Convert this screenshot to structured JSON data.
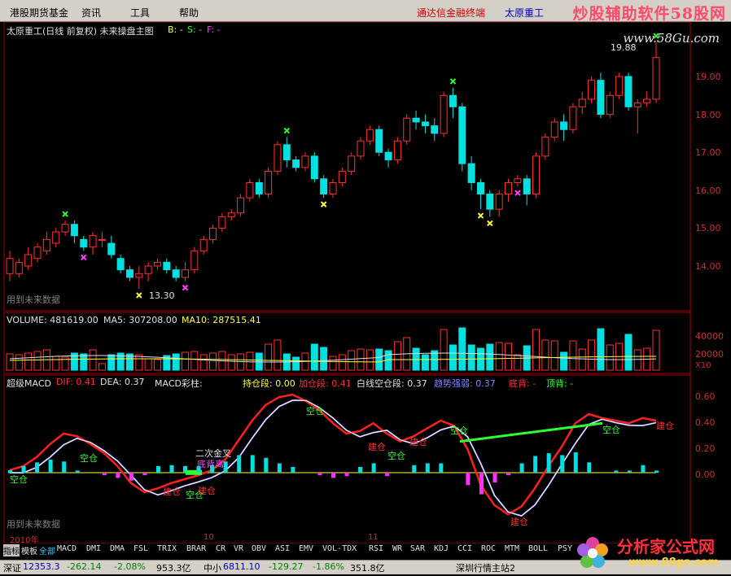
{
  "menu": {
    "items": [
      "港股期货基金",
      "资讯",
      "工具",
      "帮助"
    ],
    "ad_left": "通达信金融终端",
    "ad_right": "太原重工",
    "watermark": "炒股辅助软件58股网",
    "watermark_url": "www.58Gu.com"
  },
  "main_chart": {
    "title": "太原重工(日线 前复权) 未来操盘主图",
    "b_label": "B: -",
    "s_label": "S: -",
    "f_label": "F: -",
    "y_ticks": [
      "19.00",
      "18.00",
      "17.00",
      "16.00",
      "15.00",
      "14.00"
    ],
    "low_marker": "13.30",
    "top_marker": "19.88",
    "footer": "用到未来数据",
    "colors": {
      "up": "#ff3030",
      "down": "#00e0e0",
      "buy": "#ffff40",
      "sell": "#30ff30",
      "mark": "#ff40ff"
    }
  },
  "chart_data": {
    "type": "candlestick",
    "y_range": [
      13.0,
      20.0
    ],
    "candles": [
      [
        13.8,
        14.2,
        13.6,
        14.4
      ],
      [
        13.8,
        14.1,
        13.7,
        14.2
      ],
      [
        14.0,
        14.3,
        13.9,
        14.5
      ],
      [
        14.2,
        14.5,
        14.1,
        14.6
      ],
      [
        14.4,
        14.7,
        14.3,
        14.9
      ],
      [
        14.6,
        14.9,
        14.5,
        15.0
      ],
      [
        14.9,
        15.1,
        14.8,
        15.2
      ],
      [
        15.1,
        14.8,
        14.6,
        15.2
      ],
      [
        14.7,
        14.5,
        14.4,
        14.8
      ],
      [
        14.5,
        14.8,
        14.3,
        14.9
      ],
      [
        14.7,
        14.7,
        14.5,
        14.9
      ],
      [
        14.6,
        14.3,
        14.2,
        14.8
      ],
      [
        14.2,
        13.9,
        13.8,
        14.3
      ],
      [
        13.9,
        13.7,
        13.6,
        14.0
      ],
      [
        13.7,
        13.8,
        13.4,
        14.0
      ],
      [
        13.8,
        14.0,
        13.6,
        14.1
      ],
      [
        14.0,
        14.1,
        13.9,
        14.2
      ],
      [
        14.1,
        13.9,
        13.8,
        14.2
      ],
      [
        13.9,
        13.7,
        13.6,
        14.0
      ],
      [
        13.7,
        13.9,
        13.6,
        14.1
      ],
      [
        13.9,
        14.4,
        13.8,
        14.5
      ],
      [
        14.4,
        14.7,
        14.3,
        14.8
      ],
      [
        14.7,
        15.0,
        14.6,
        15.1
      ],
      [
        15.0,
        15.3,
        14.9,
        15.4
      ],
      [
        15.3,
        15.4,
        15.2,
        15.5
      ],
      [
        15.4,
        15.8,
        15.3,
        15.9
      ],
      [
        15.8,
        16.2,
        15.7,
        16.3
      ],
      [
        16.2,
        15.9,
        15.8,
        16.3
      ],
      [
        15.9,
        16.5,
        15.8,
        16.6
      ],
      [
        16.5,
        17.2,
        16.4,
        17.3
      ],
      [
        17.2,
        16.8,
        16.6,
        17.4
      ],
      [
        16.8,
        16.6,
        16.5,
        16.9
      ],
      [
        16.6,
        16.9,
        16.5,
        17.0
      ],
      [
        16.9,
        16.3,
        16.2,
        17.0
      ],
      [
        16.3,
        15.9,
        15.8,
        16.4
      ],
      [
        15.9,
        16.2,
        15.8,
        16.3
      ],
      [
        16.2,
        16.5,
        16.1,
        16.6
      ],
      [
        16.5,
        16.9,
        16.4,
        17.0
      ],
      [
        16.9,
        17.3,
        16.8,
        17.4
      ],
      [
        17.3,
        17.6,
        17.2,
        17.7
      ],
      [
        17.6,
        17.0,
        16.9,
        17.7
      ],
      [
        17.0,
        16.8,
        16.6,
        17.1
      ],
      [
        16.8,
        17.3,
        16.7,
        17.4
      ],
      [
        17.3,
        17.9,
        17.2,
        18.0
      ],
      [
        17.9,
        17.8,
        17.6,
        18.1
      ],
      [
        17.8,
        17.7,
        17.5,
        18.0
      ],
      [
        17.7,
        17.5,
        17.3,
        17.9
      ],
      [
        17.5,
        18.5,
        17.4,
        18.6
      ],
      [
        18.5,
        18.2,
        17.9,
        18.7
      ],
      [
        18.2,
        16.7,
        16.5,
        18.3
      ],
      [
        16.7,
        16.2,
        16.0,
        16.9
      ],
      [
        16.2,
        15.9,
        15.5,
        16.3
      ],
      [
        15.9,
        15.5,
        15.3,
        16.0
      ],
      [
        15.5,
        15.9,
        15.3,
        16.0
      ],
      [
        15.9,
        16.2,
        15.7,
        16.3
      ],
      [
        16.2,
        16.3,
        16.1,
        16.4
      ],
      [
        16.3,
        15.9,
        15.6,
        16.4
      ],
      [
        15.9,
        16.9,
        15.8,
        17.0
      ],
      [
        16.9,
        17.4,
        16.8,
        17.5
      ],
      [
        17.4,
        17.8,
        17.3,
        17.9
      ],
      [
        17.8,
        17.6,
        17.3,
        18.0
      ],
      [
        17.6,
        18.2,
        17.5,
        18.3
      ],
      [
        18.2,
        18.4,
        18.0,
        18.6
      ],
      [
        18.4,
        18.9,
        18.3,
        19.0
      ],
      [
        18.9,
        18.0,
        17.9,
        19.1
      ],
      [
        18.0,
        18.5,
        17.9,
        18.6
      ],
      [
        18.5,
        19.0,
        18.4,
        19.1
      ],
      [
        19.0,
        18.2,
        18.1,
        19.1
      ],
      [
        18.2,
        18.3,
        17.5,
        18.4
      ],
      [
        18.3,
        18.4,
        18.2,
        18.6
      ],
      [
        18.4,
        19.5,
        18.3,
        19.9
      ]
    ],
    "volume": {
      "label": "VOLUME: 481619.00",
      "ma5": "MA5: 307208.00",
      "ma10": "MA10: 287515.41",
      "ticks": [
        "40000",
        "20000",
        "X10"
      ]
    },
    "macd": {
      "title": "超级MACD",
      "dif": "DIF: 0.41",
      "dea": "DEA: 0.37",
      "col_label": "MACD彩柱:",
      "hold": "持仓段: 0.00",
      "add": "加仓段: 0.41",
      "white_empty": "白线空仓段: 0.37",
      "trend": "趋势强弱: 0.37",
      "bottom_div": "底背: -",
      "top_div": "顶背: -",
      "ticks": [
        "0.60",
        "0.40",
        "0.20",
        "0.00"
      ],
      "annotations": [
        "空仓",
        "空仓",
        "建仓",
        "空仓",
        "建仓",
        "二次金叉",
        "底背离",
        "空仓",
        "建仓",
        "空仓",
        "建仓",
        "空仓",
        "建仓",
        "空仓",
        "建仓"
      ],
      "footer": "用到未来数据"
    }
  },
  "dates": {
    "d1": "2010年",
    "d2": "10",
    "d3": "11"
  },
  "tabs": [
    "指标",
    "模板",
    "全部",
    "MACD",
    "DMI",
    "DMA",
    "FSL",
    "TRIX",
    "BRAR",
    "CR",
    "VR",
    "OBV",
    "ASI",
    "EMV",
    "VOL-TDX",
    "RSI",
    "WR",
    "SAR",
    "KDJ",
    "CCI",
    "ROC",
    "MTM",
    "BOLL",
    "PSY",
    "MCS"
  ],
  "status": {
    "s1": "深证",
    "s2": "12353.3",
    "s3": "-262.14",
    "s4": "-2.08%",
    "s5": "953.3亿",
    "s6": "中小",
    "s7": "6811.10",
    "s8": "-129.27",
    "s9": "-1.86%",
    "s10": "351.8亿",
    "s11": "深圳行情主站2"
  },
  "logo": {
    "name": "分析家公式网",
    "url": "www.88gs.com"
  }
}
